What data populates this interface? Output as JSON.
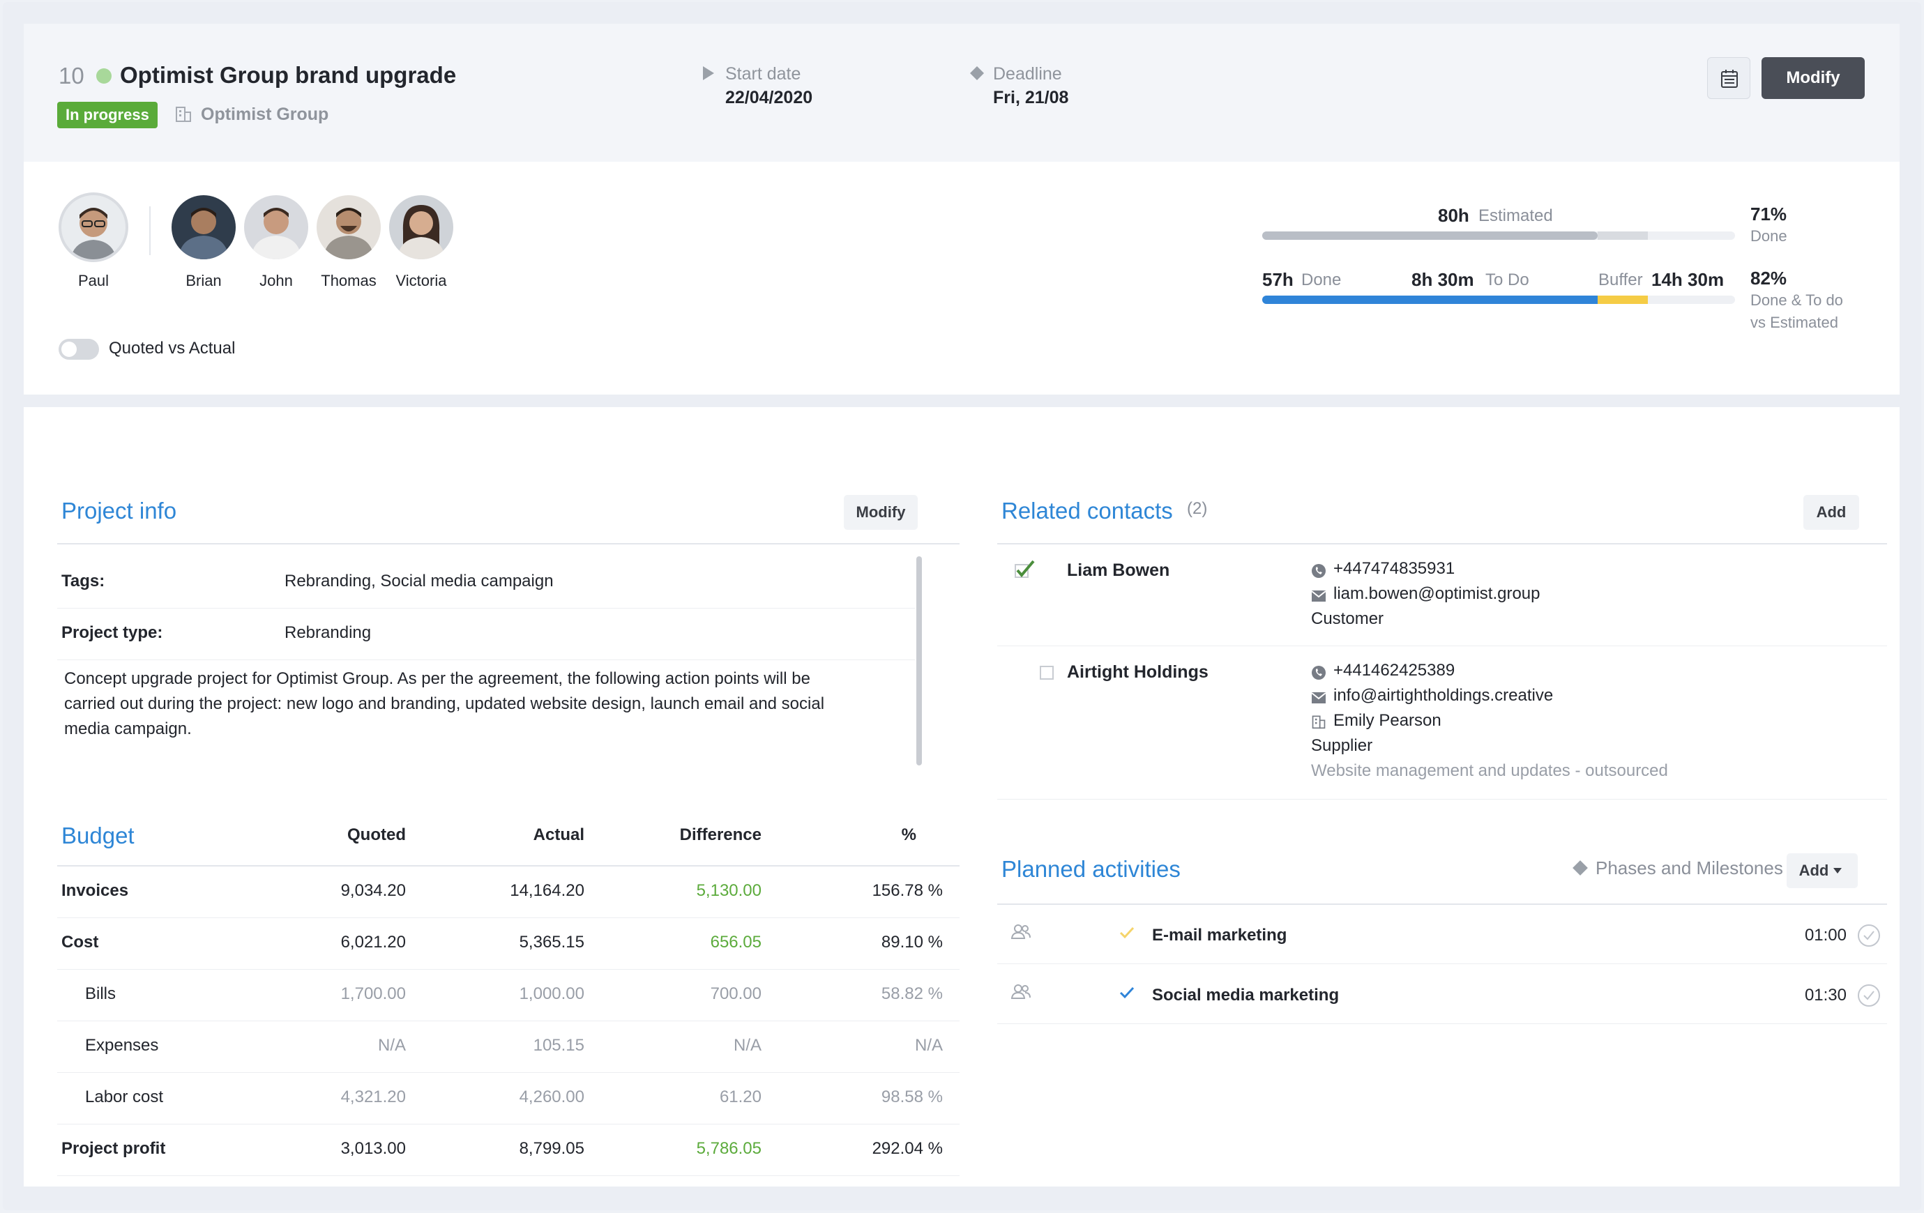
{
  "project": {
    "number": "10",
    "title": "Optimist Group brand upgrade",
    "status": "In progress",
    "client": "Optimist Group",
    "start_label": "Start date",
    "start_value": "22/04/2020",
    "deadline_label": "Deadline",
    "deadline_value": "Fri, 21/08",
    "modify_label": "Modify",
    "colors": {
      "status_badge": "#5aab3a",
      "status_dot": "#a8d89a",
      "accent": "#2e86d6",
      "progress_blue": "#2f84d8",
      "buffer_yellow": "#f5cc45"
    }
  },
  "team": {
    "owner": "Paul",
    "members": [
      "Brian",
      "John",
      "Thomas",
      "Victoria"
    ],
    "toggle_label": "Quoted vs Actual"
  },
  "estimate": {
    "estimated_hours": "80h",
    "estimated_label": "Estimated",
    "done_pct": "71%",
    "done_label": "Done",
    "done_hours": "57h",
    "done_hours_label": "Done",
    "todo_hours": "8h 30m",
    "todo_label": "To Do",
    "buffer_label": "Buffer",
    "buffer_hours": "14h 30m",
    "done_todo_pct": "82%",
    "done_todo_label1": "Done & To do",
    "done_todo_label2": "vs Estimated",
    "bars": {
      "estimated_fill": 0.71,
      "estimated_buffer_end": 0.815,
      "done_fill": 0.71,
      "buffer_end": 0.815
    }
  },
  "project_info": {
    "title": "Project info",
    "modify_label": "Modify",
    "tags_label": "Tags:",
    "tags_value": "Rebranding, Social media campaign",
    "type_label": "Project type:",
    "type_value": "Rebranding",
    "description": [
      "Concept upgrade project for Optimist Group. As per the agreement, the following action points will be",
      "carried out during the project: new logo and branding, updated website design, launch email and social",
      "media campaign."
    ]
  },
  "budget": {
    "title": "Budget",
    "headers": [
      "Quoted",
      "Actual",
      "Difference",
      "%"
    ],
    "rows": [
      {
        "label": "Invoices",
        "quoted": "9,034.20",
        "actual": "14,164.20",
        "diff": "5,130.00",
        "pct": "156.78 %"
      },
      {
        "label": "Cost",
        "quoted": "6,021.20",
        "actual": "5,365.15",
        "diff": "656.05",
        "pct": "89.10 %"
      },
      {
        "label": "Bills",
        "quoted": "1,700.00",
        "actual": "1,000.00",
        "diff": "700.00",
        "pct": "58.82 %"
      },
      {
        "label": "Expenses",
        "quoted": "N/A",
        "actual": "105.15",
        "diff": "N/A",
        "pct": "N/A"
      },
      {
        "label": "Labor cost",
        "quoted": "4,321.20",
        "actual": "4,260.00",
        "diff": "61.20",
        "pct": "98.58 %"
      },
      {
        "label": "Project profit",
        "quoted": "3,013.00",
        "actual": "8,799.05",
        "diff": "5,786.05",
        "pct": "292.04 %"
      }
    ]
  },
  "contacts": {
    "title": "Related contacts",
    "count": "(2)",
    "add_label": "Add",
    "items": [
      {
        "name": "Liam Bowen",
        "phone": "+447474835931",
        "email": "liam.bowen@optimist.group",
        "role": "Customer"
      },
      {
        "name": "Airtight Holdings",
        "phone": "+441462425389",
        "email": "info@airtightholdings.creative",
        "person": "Emily Pearson",
        "role": "Supplier",
        "note": "Website management and updates - outsourced"
      }
    ]
  },
  "activities": {
    "title": "Planned activities",
    "phases_label": "Phases and Milestones",
    "add_label": "Add",
    "items": [
      {
        "name": "E-mail marketing",
        "time": "01:00"
      },
      {
        "name": "Social media marketing",
        "time": "01:30"
      }
    ]
  }
}
